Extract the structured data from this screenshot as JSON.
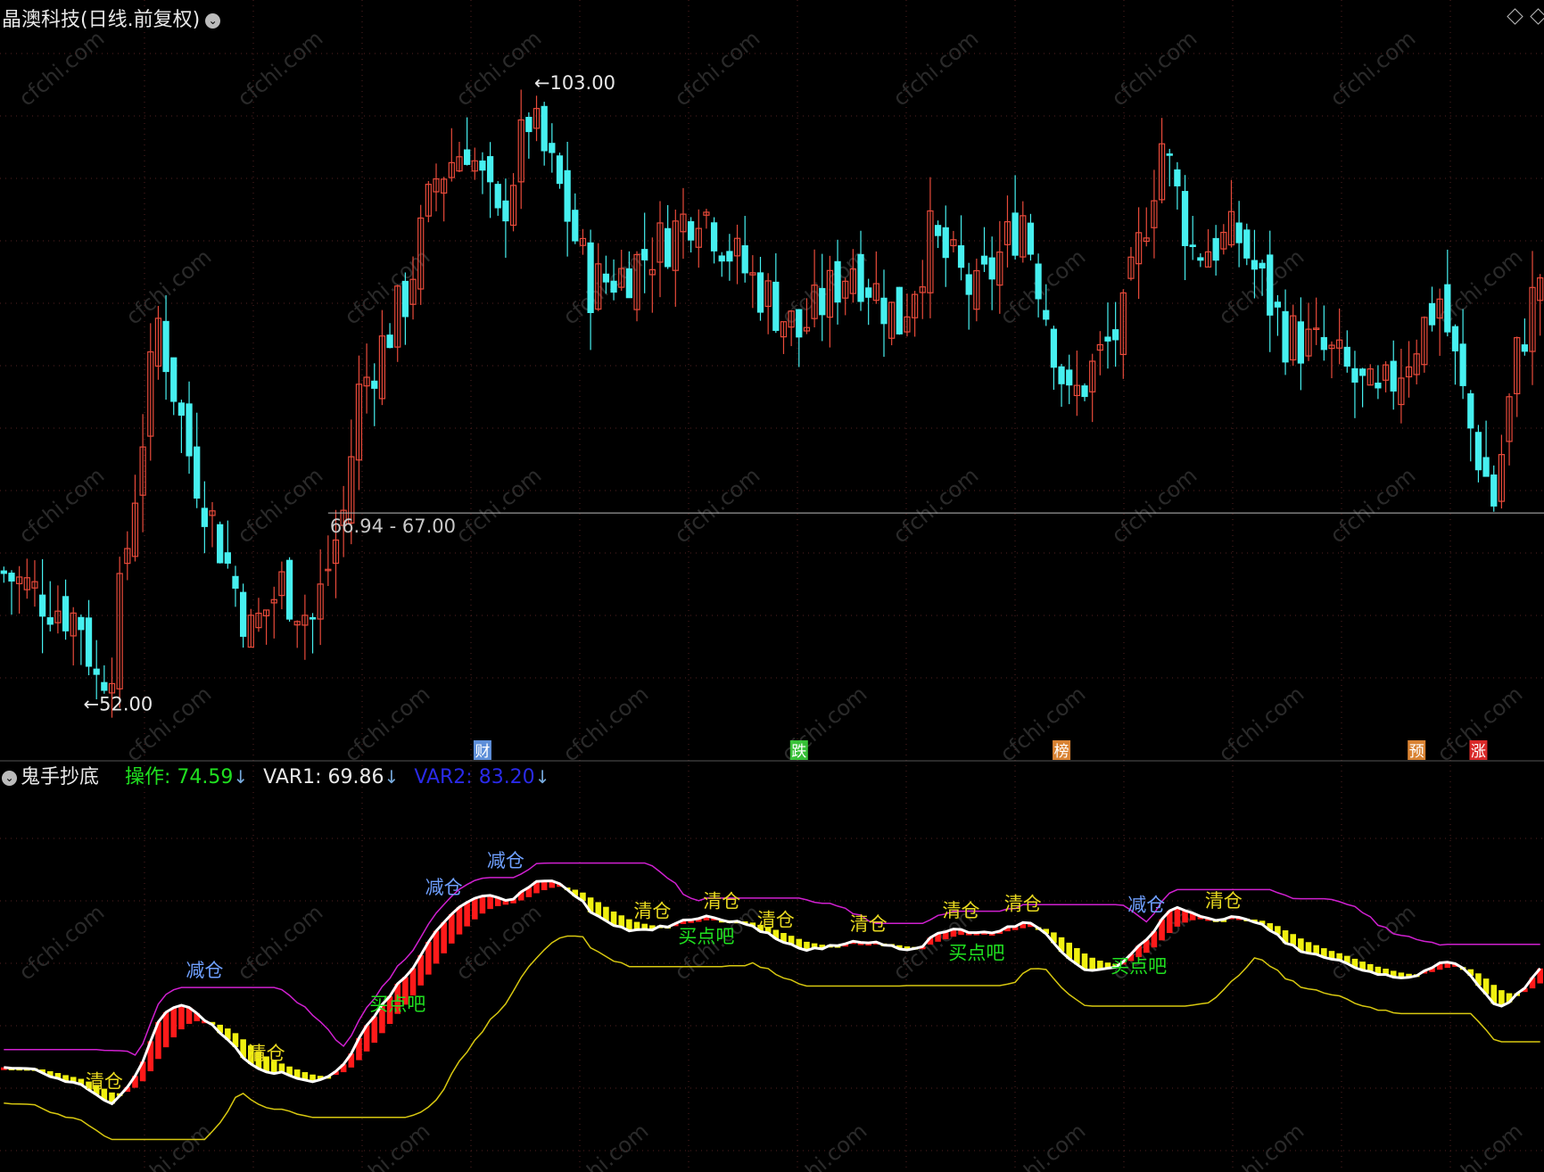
{
  "header": {
    "title": "晶澳科技(日线.前复权)",
    "dropdown_icon": "chevron-down-icon",
    "window_controls": [
      "diamond-icon",
      "diamond-icon"
    ]
  },
  "price_chart": {
    "high_label": "103.00",
    "low_label": "52.00",
    "price_line_label": "66.94 - 67.00",
    "price_line_value": 67.0,
    "markers": [
      {
        "text": "财",
        "bar": 62,
        "color": "#6fa8ff"
      },
      {
        "text": "跌",
        "bar": 103,
        "color": "#40e040"
      },
      {
        "text": "榜",
        "bar": 137,
        "color": "#ff9a3c"
      },
      {
        "text": "预",
        "bar": 183,
        "color": "#ff9a3c"
      },
      {
        "text": "涨",
        "bar": 191,
        "color": "#ff3030"
      }
    ],
    "colors": {
      "up": "#e84a3a",
      "down": "#46f0f0",
      "grid": "#552222"
    }
  },
  "indicator": {
    "name": "鬼手抄底",
    "values": [
      {
        "label": "操作: 74.59",
        "color": "#20e020",
        "arrow": "↓"
      },
      {
        "label": "VAR1: 69.86",
        "color": "#e8e8e8",
        "arrow": "↓"
      },
      {
        "label": "VAR2: 83.20",
        "color": "#2a2ae8",
        "arrow": "↓"
      }
    ],
    "signals": [
      {
        "text": "减仓",
        "bar": 26,
        "color": "#6fa0ff"
      },
      {
        "text": "减仓",
        "bar": 57,
        "color": "#6fa0ff"
      },
      {
        "text": "减仓",
        "bar": 65,
        "color": "#6fa0ff"
      },
      {
        "text": "减仓",
        "bar": 148,
        "color": "#6fa0ff"
      },
      {
        "text": "清仓",
        "bar": 13,
        "color": "#e8d820"
      },
      {
        "text": "清仓",
        "bar": 34,
        "color": "#e8d820"
      },
      {
        "text": "清仓",
        "bar": 84,
        "color": "#e8d820"
      },
      {
        "text": "清仓",
        "bar": 93,
        "color": "#e8d820"
      },
      {
        "text": "清仓",
        "bar": 100,
        "color": "#e8d820"
      },
      {
        "text": "清仓",
        "bar": 112,
        "color": "#e8d820"
      },
      {
        "text": "清仓",
        "bar": 124,
        "color": "#e8d820"
      },
      {
        "text": "清仓",
        "bar": 132,
        "color": "#e8d820"
      },
      {
        "text": "清仓",
        "bar": 158,
        "color": "#e8d820"
      },
      {
        "text": "买点吧",
        "bar": 51,
        "color": "#20e020"
      },
      {
        "text": "买点吧",
        "bar": 91,
        "color": "#20e020"
      },
      {
        "text": "买点吧",
        "bar": 126,
        "color": "#20e020"
      },
      {
        "text": "买点吧",
        "bar": 147,
        "color": "#20e020"
      }
    ]
  },
  "watermark": "cfchi.com"
}
